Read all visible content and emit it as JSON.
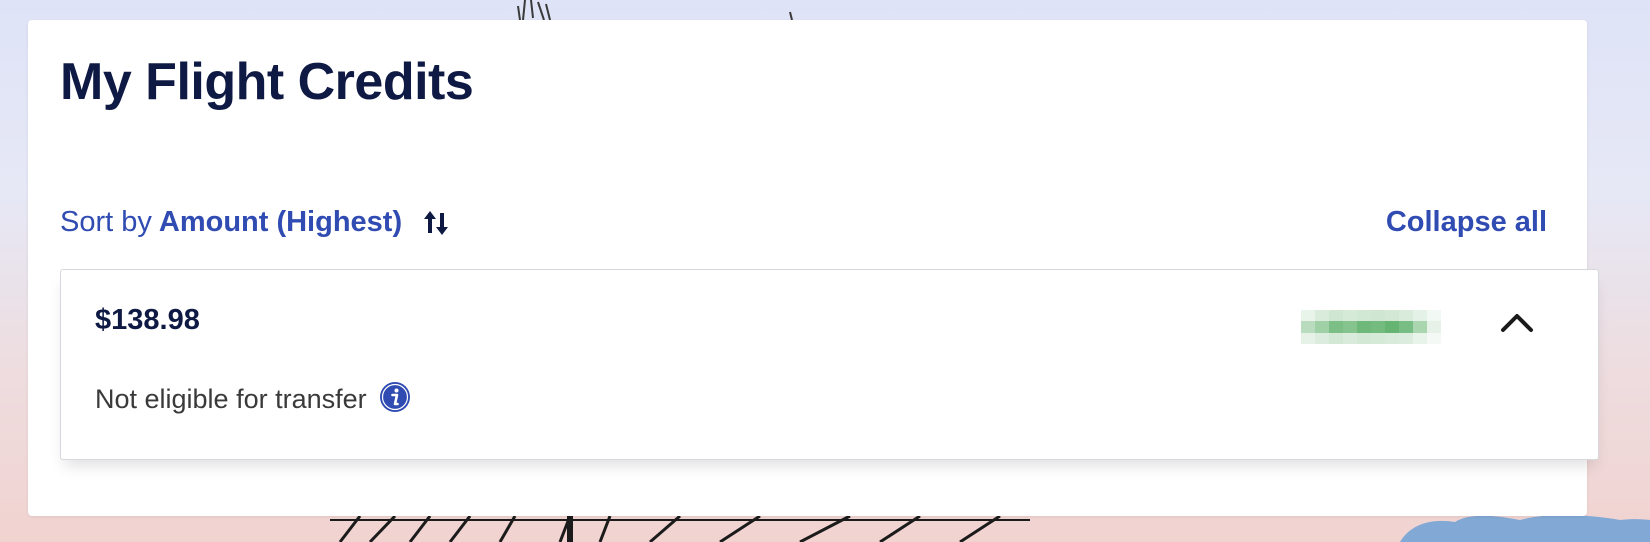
{
  "page": {
    "title": "My Flight Credits"
  },
  "sort": {
    "prefix": "Sort by",
    "value": "Amount (Highest)",
    "icon": "sort-arrows-icon"
  },
  "actions": {
    "collapse_all": "Collapse all"
  },
  "credits": [
    {
      "amount": "$138.98",
      "transfer_status": "Not eligible for transfer",
      "info_icon": "info-icon",
      "toggle_icon": "chevron-up-icon",
      "expanded": true
    }
  ],
  "colors": {
    "brand_navy": "#0f1a44",
    "link_blue": "#304cb2",
    "redacted_green": "#5fb46f"
  }
}
